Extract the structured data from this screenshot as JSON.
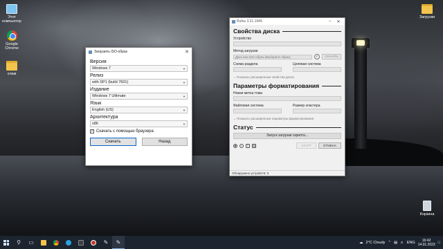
{
  "desktop": {
    "icons": [
      {
        "label": "Этот компьютер",
        "icon": "computer-icon"
      },
      {
        "label": "Google Chrome",
        "icon": "chrome-icon"
      },
      {
        "label": "хлам",
        "icon": "folder-icon"
      },
      {
        "label": "Загрузки",
        "icon": "downloads-folder-icon"
      },
      {
        "label": "Корзина",
        "icon": "recycle-bin-icon"
      }
    ]
  },
  "rufus": {
    "title": "Rufus 3.21.1949",
    "drive_section": "Свойства диска",
    "device_label": "Устройство",
    "device_value": "",
    "boot_label": "Метод загрузки",
    "boot_value": "Диск или ISO-образ (Выберите образ)",
    "select_button": "СКАЧАТЬ",
    "partition_label": "Схема раздела",
    "target_label": "Целевая система",
    "advanced_drive": "Показать расширенные свойства диска",
    "format_section": "Параметры форматирования",
    "volume_label": "Новая метка тома",
    "fs_label": "Файловая система",
    "cluster_label": "Размер кластера",
    "advanced_format": "Показать расширенные параметры форматирования",
    "status_section": "Статус",
    "status_text": "Запуск загрузки скрипта...",
    "start_button": "СТАРТ",
    "cancel_button": "ОТМЕНА",
    "footer": "Обнаружено устройств: 0"
  },
  "iso_dialog": {
    "title": "Загрузить ISO-образ",
    "version_label": "Версия",
    "version_value": "Windows 7",
    "release_label": "Релиз",
    "release_value": "with SP1 (build 7601)",
    "edition_label": "Издание",
    "edition_value": "Windows 7 Ultimate",
    "language_label": "Язык",
    "language_value": "English (US)",
    "arch_label": "Архитектура",
    "arch_value": "x86",
    "browser_checkbox": "Скачать с помощью браузера",
    "browser_checked": true,
    "download_button": "Скачать",
    "back_button": "Назад"
  },
  "taskbar": {
    "weather": "2°C Cloudy",
    "language": "ENG",
    "time": "16:42",
    "date": "14.01.2023"
  }
}
